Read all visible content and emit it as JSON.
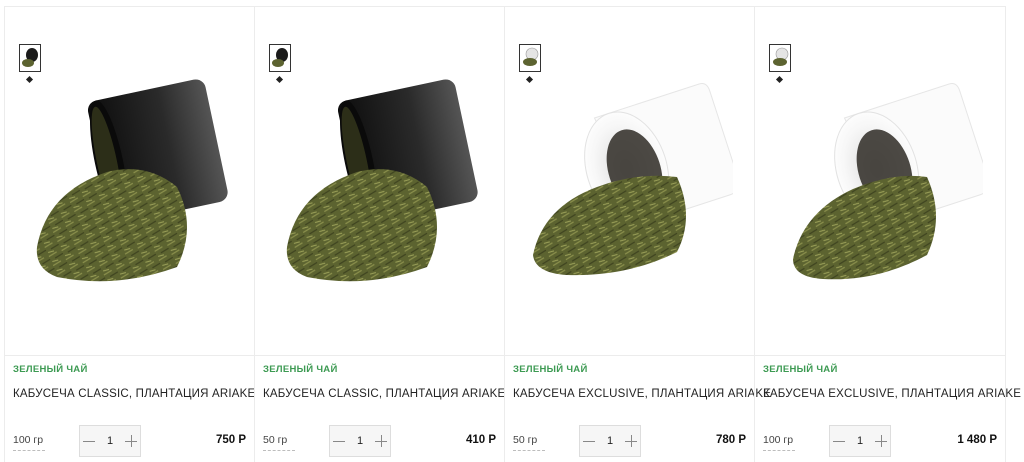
{
  "products": [
    {
      "category": "ЗЕЛЕНЫЙ ЧАЙ",
      "title": "КАБУСЕЧА CLASSIC, ПЛАНТАЦИЯ ARIAKE",
      "weight": "100 гр",
      "quantity": "1",
      "price": "750 Р",
      "image": "black-cup-spilled-tea"
    },
    {
      "category": "ЗЕЛЕНЫЙ ЧАЙ",
      "title": "КАБУСЕЧА CLASSIC, ПЛАНТАЦИЯ ARIAKE",
      "weight": "50 гр",
      "quantity": "1",
      "price": "410 Р",
      "image": "black-cup-spilled-tea"
    },
    {
      "category": "ЗЕЛЕНЫЙ ЧАЙ",
      "title": "КАБУСЕЧА EXCLUSIVE, ПЛАНТАЦИЯ ARIAKE",
      "weight": "50 гр",
      "quantity": "1",
      "price": "780 Р",
      "image": "white-cup-spilled-tea"
    },
    {
      "category": "ЗЕЛЕНЫЙ ЧАЙ",
      "title": "КАБУСЕЧА EXCLUSIVE, ПЛАНТАЦИЯ ARIAKE",
      "weight": "100 гр",
      "quantity": "1",
      "price": "1 480 Р",
      "image": "white-cup-spilled-tea"
    }
  ],
  "colors": {
    "category": "#3c9a52",
    "tea_leaf": "#6a7038",
    "black_cup": "#1b1b1b",
    "white_cup": "#f2f2f2"
  }
}
